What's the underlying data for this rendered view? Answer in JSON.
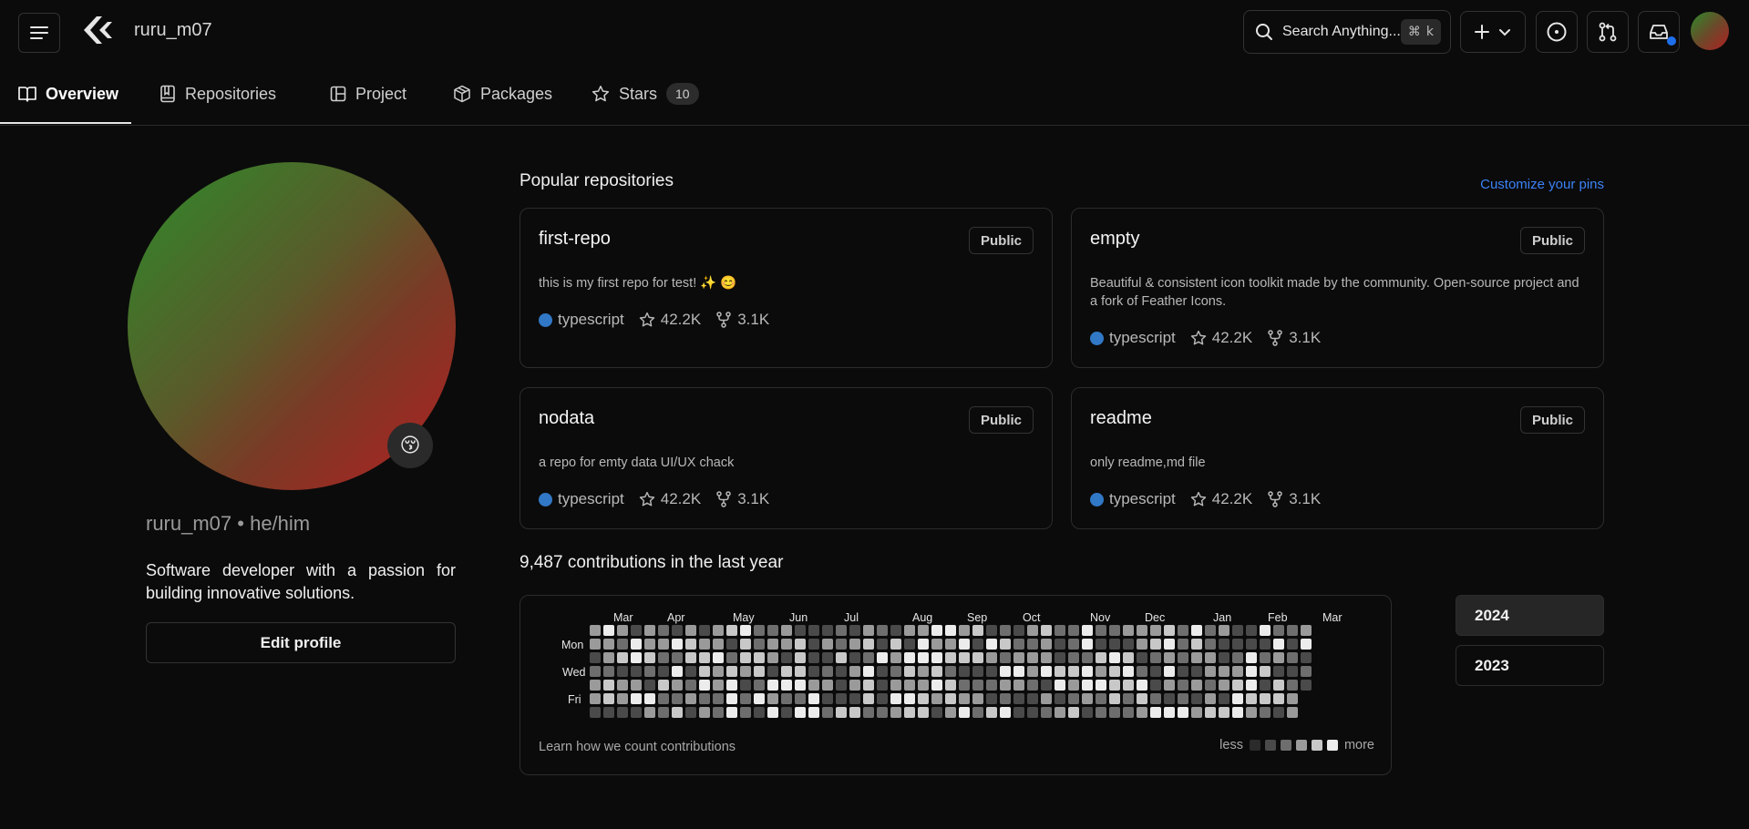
{
  "header": {
    "username": "ruru_m07",
    "search_placeholder": "Search Anything...",
    "search_shortcut_symbol": "⌘",
    "search_shortcut_key": "k"
  },
  "tabs": [
    {
      "label": "Overview",
      "icon": "book-icon",
      "active": true
    },
    {
      "label": "Repositories",
      "icon": "repo-icon"
    },
    {
      "label": "Project",
      "icon": "project-icon"
    },
    {
      "label": "Packages",
      "icon": "package-icon"
    },
    {
      "label": "Stars",
      "icon": "star-icon",
      "count": "10"
    }
  ],
  "profile": {
    "name_line": "ruru_m07 • he/him",
    "bio": "Software developer with a passion for building innovative solutions.",
    "edit_label": "Edit profile",
    "status_emoji": "😚"
  },
  "repos_section": {
    "title": "Popular repositories",
    "customize_label": "Customize your pins"
  },
  "repos": [
    {
      "name": "first-repo",
      "visibility": "Public",
      "description": "this is my first repo for test! ✨ 😊",
      "language": "typescript",
      "stars": "42.2K",
      "forks": "3.1K"
    },
    {
      "name": "empty",
      "visibility": "Public",
      "description": "Beautiful & consistent icon toolkit made by the community. Open-source project and a fork of Feather Icons.",
      "language": "typescript",
      "stars": "42.2K",
      "forks": "3.1K"
    },
    {
      "name": "nodata",
      "visibility": "Public",
      "description": "a repo for emty data UI/UX chack",
      "language": "typescript",
      "stars": "42.2K",
      "forks": "3.1K"
    },
    {
      "name": "readme",
      "visibility": "Public",
      "description": "only readme,md file",
      "language": "typescript",
      "stars": "42.2K",
      "forks": "3.1K"
    }
  ],
  "contributions": {
    "title": "9,487 contributions in the last year",
    "months": [
      "Mar",
      "Apr",
      "May",
      "Jun",
      "Jul",
      "Aug",
      "Sep",
      "Oct",
      "Nov",
      "Dec",
      "Jan",
      "Feb",
      "Mar"
    ],
    "days": [
      "Mon",
      "Wed",
      "Fri"
    ],
    "learn_label": "Learn how we count contributions",
    "legend_less": "less",
    "legend_more": "more",
    "levels_colors": [
      "#2b2b2b",
      "#4a4a4a",
      "#6e6e6e",
      "#9a9a9a",
      "#c8c8c8",
      "#ececec"
    ]
  },
  "years": [
    "2024",
    "2023"
  ],
  "colors": {
    "accent": "#3b82f6",
    "language_dot": "#3178c6",
    "notification_dot": "#1f6feb"
  }
}
